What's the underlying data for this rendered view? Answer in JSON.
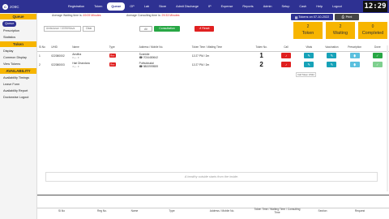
{
  "app": {
    "brand_logo": "C",
    "brand_name": "zOIIC",
    "clock": "12:29"
  },
  "nav": [
    "Registration",
    "Token",
    "Queue",
    "OP",
    "Lab",
    "Store",
    "Admit Discharge",
    "IP",
    "Expense",
    "Reports",
    "Admin",
    "Setup",
    "Cash",
    "Help",
    "Logout"
  ],
  "nav_active": "Queue",
  "sidebar": {
    "queue_head": "Queue",
    "queue_items": [
      "Queue",
      "Prescription",
      "Statistics"
    ],
    "token_head": "Token",
    "token_items": [
      "Display",
      "Common Display",
      "View Tokens"
    ],
    "availability_head": "AVAILABILITY",
    "availability_items": [
      "Availability Timings",
      "Leave Form",
      "Availability Report",
      "Doctorwise Logout"
    ]
  },
  "header": {
    "avg_wait_label": "Average Waiting time is:",
    "avg_wait_value": "49:09 Minutes",
    "avg_consult_label": "Average Consulting time is:",
    "avg_consult_value": "29:33 Minutes",
    "token_date": "Tokens on 07-10-2022",
    "print_label": "Print"
  },
  "filters": {
    "search_placeholder": "Ambulance / 100MHAs/a",
    "clear_label": "Clear",
    "all_label": "All",
    "consultation_label": "Consultation",
    "reset_label": "Reset"
  },
  "stats": [
    {
      "num": "2",
      "label": "Token"
    },
    {
      "num": "2",
      "label": "Waiting"
    },
    {
      "num": "0",
      "label": "Completed"
    }
  ],
  "table": {
    "headers": {
      "slno": "Sl.No",
      "uhid": "UHID",
      "name": "Name",
      "type": "Type",
      "address": "Address / Mobile No.",
      "time": "Token Time / Waiting Time",
      "token": "Token No.",
      "call": "Call",
      "vitals": "Vitals",
      "vaccination": "Vaccination",
      "prescription": "Prescription",
      "done": "Done"
    },
    "rows": [
      {
        "slno": "1",
        "uhid": "022080002",
        "name": "Ansitha",
        "agesex": "0 y - F",
        "type": "Rev",
        "address": "Sunnidie",
        "mobile": "7034480642",
        "time": "12:27 PM / 2m",
        "token": "1"
      },
      {
        "slno": "2",
        "uhid": "022080003",
        "name": "Hari Dhandara",
        "agesex": "4 y - F",
        "type": "Rev",
        "address": "Puthukkudai",
        "mobile": "9800999559",
        "time": "12:27 PM / 2m",
        "token": "2"
      }
    ],
    "call_tooltip": "Call Token 1/Mid"
  },
  "quote": "A healthy outside starts from the inside.",
  "bottom_headers": [
    "Sl.No",
    "Reg No.",
    "Name",
    "Type",
    "Address / Mobile No.",
    "Token Time / Waiting Time / Consulting Time",
    "Section",
    "Request"
  ],
  "colors": {
    "primary": "#2e3192",
    "accent": "#f7b500",
    "danger": "#e02020",
    "success": "#28a745",
    "info": "#17a2b8"
  }
}
